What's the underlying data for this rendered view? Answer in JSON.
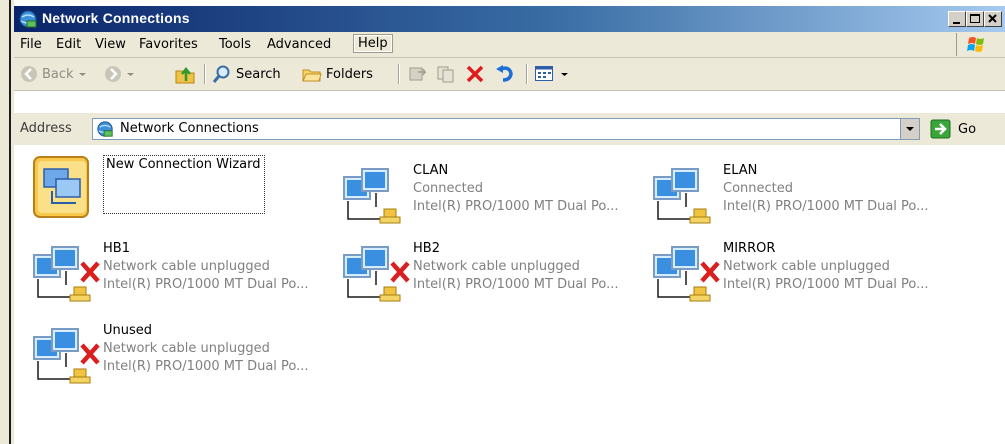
{
  "window": {
    "title": "Network Connections"
  },
  "menu": [
    {
      "label": "File"
    },
    {
      "label": "Edit"
    },
    {
      "label": "View"
    },
    {
      "label": "Favorites"
    },
    {
      "label": "Tools"
    },
    {
      "label": "Advanced"
    },
    {
      "label": "Help"
    }
  ],
  "toolbar": {
    "back": "Back",
    "search": "Search",
    "folders": "Folders"
  },
  "address": {
    "label": "Address",
    "value": "Network Connections",
    "go": "Go"
  },
  "items": [
    {
      "name": "New Connection Wizard",
      "status": "",
      "device": "",
      "kind": "wizard"
    },
    {
      "name": "CLAN",
      "status": "Connected",
      "device": "Intel(R) PRO/1000 MT Dual Po...",
      "kind": "connected"
    },
    {
      "name": "ELAN",
      "status": "Connected",
      "device": "Intel(R) PRO/1000 MT Dual Po...",
      "kind": "connected"
    },
    {
      "name": "HB1",
      "status": "Network cable unplugged",
      "device": "Intel(R) PRO/1000 MT Dual Po...",
      "kind": "unplugged"
    },
    {
      "name": "HB2",
      "status": "Network cable unplugged",
      "device": "Intel(R) PRO/1000 MT Dual Po...",
      "kind": "unplugged"
    },
    {
      "name": "MIRROR",
      "status": "Network cable unplugged",
      "device": "Intel(R) PRO/1000 MT Dual Po...",
      "kind": "unplugged"
    },
    {
      "name": "Unused",
      "status": "Network cable unplugged",
      "device": "Intel(R) PRO/1000 MT Dual Po...",
      "kind": "unplugged"
    }
  ],
  "colors": {
    "titlebar_start": "#0a246a",
    "titlebar_end": "#a6caf0",
    "chrome": "#ece9d8",
    "status_text": "#808080"
  }
}
